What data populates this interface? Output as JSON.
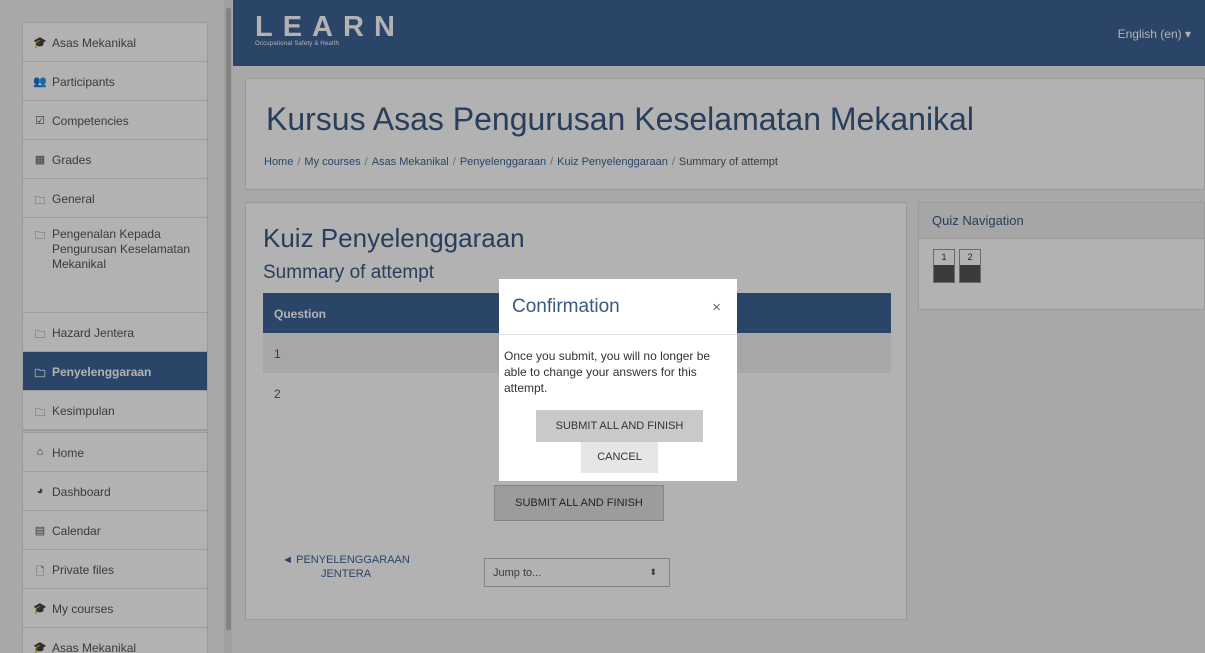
{
  "sidebar": {
    "group1": [
      {
        "label": "Asas Mekanikal",
        "icon": "graduation-cap-icon",
        "glyph": "🎓"
      },
      {
        "label": "Participants",
        "icon": "users-icon",
        "glyph": "👥"
      },
      {
        "label": "Competencies",
        "icon": "check-square-icon",
        "glyph": "☑"
      },
      {
        "label": "Grades",
        "icon": "table-icon",
        "glyph": "▦"
      },
      {
        "label": "General",
        "icon": "folder-icon",
        "glyph": "🗀"
      },
      {
        "label": "Pengenalan Kepada Pengurusan Keselamatan Mekanikal",
        "icon": "folder-icon",
        "glyph": "🗀"
      },
      {
        "label": "Hazard Jentera",
        "icon": "folder-icon",
        "glyph": "🗀"
      },
      {
        "label": "Penyelenggaraan",
        "icon": "folder-icon",
        "glyph": "🗀",
        "active": true
      },
      {
        "label": "Kesimpulan",
        "icon": "folder-icon",
        "glyph": "🗀"
      }
    ],
    "group2": [
      {
        "label": "Home",
        "icon": "home-icon",
        "glyph": "⌂"
      },
      {
        "label": "Dashboard",
        "icon": "dashboard-icon",
        "glyph": "◕"
      },
      {
        "label": "Calendar",
        "icon": "calendar-icon",
        "glyph": "▤"
      },
      {
        "label": "Private files",
        "icon": "file-icon",
        "glyph": "🗋"
      },
      {
        "label": "My courses",
        "icon": "graduation-cap-icon",
        "glyph": "🎓"
      },
      {
        "label": "Asas Mekanikal",
        "icon": "graduation-cap-icon",
        "glyph": "🎓"
      }
    ]
  },
  "header": {
    "logo_main": "LEARN",
    "logo_sub": "Occupational Safety & Health",
    "language": "English (en) ▾"
  },
  "page": {
    "title": "Kursus Asas Pengurusan Keselamatan Mekanikal",
    "breadcrumb": [
      "Home",
      "My courses",
      "Asas Mekanikal",
      "Penyelenggaraan",
      "Kuiz Penyelenggaraan",
      "Summary of attempt"
    ]
  },
  "main": {
    "quiz_title": "Kuiz Penyelenggaraan",
    "summary_title": "Summary of attempt",
    "table_header": "Question",
    "rows": [
      "1",
      "2"
    ],
    "submit_label": "SUBMIT ALL AND FINISH",
    "prev_link": "◄ PENYELENGGARAAN JENTERA",
    "jump_placeholder": "Jump to...",
    "jump_arrow": "⬍"
  },
  "quiz_nav": {
    "title": "Quiz Navigation",
    "buttons": [
      "1",
      "2"
    ]
  },
  "modal": {
    "title": "Confirmation",
    "close": "×",
    "body": "Once you submit, you will no longer be able to change your answers for this attempt.",
    "submit": "SUBMIT ALL AND FINISH",
    "cancel": "CANCEL"
  }
}
